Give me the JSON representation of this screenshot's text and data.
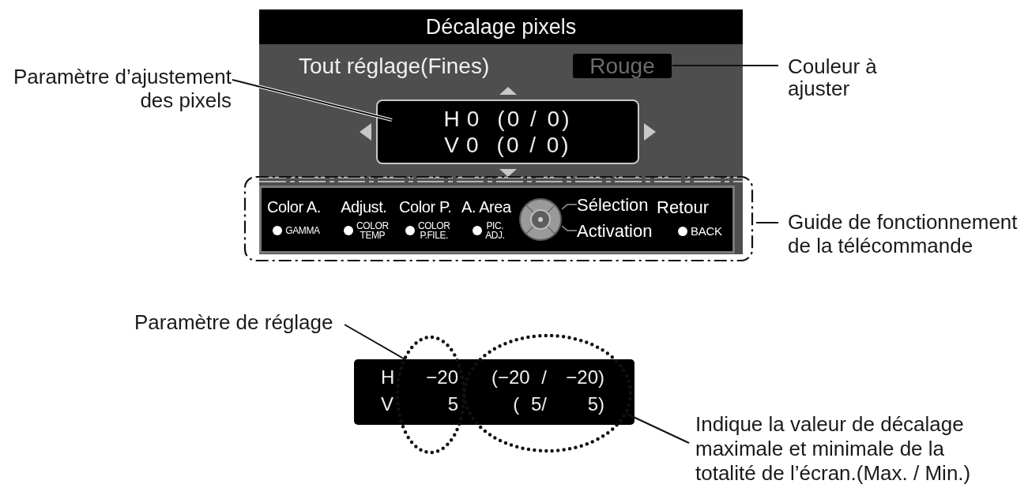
{
  "screen": {
    "title": "Décalage pixels",
    "mode": "Tout réglage(Fines)",
    "color_channel": "Rouge",
    "readout": [
      {
        "axis": "H",
        "value": "0",
        "range": "(0 / 0)"
      },
      {
        "axis": "V",
        "value": "0",
        "range": "(0 / 0)"
      }
    ],
    "guide": {
      "keys": [
        {
          "label": "Color A.",
          "button": "GAMMA"
        },
        {
          "label": "Adjust.",
          "button": "COLOR\nTEMP"
        },
        {
          "label": "Color P.",
          "button": "COLOR\nP.FILE."
        },
        {
          "label": "A. Area",
          "button": "PIC.\nADJ."
        }
      ],
      "joystick": {
        "select": "Sélection",
        "enter": "Activation"
      },
      "back": {
        "label": "Retour",
        "button": "BACK"
      }
    }
  },
  "callouts": {
    "pixel_parameter": "Paramètre d’ajustement\ndes pixels",
    "color_to_adjust": "Couleur à\najuster",
    "remote_guide": "Guide de fonctionnement\nde la télécommande",
    "setting_parameter": "Paramètre de réglage",
    "range_note": "Indique la valeur de décalage\nmaximale et minimale de la\ntotalité de l’écran.(Max. / Min.)"
  },
  "example": {
    "rows": [
      {
        "axis": "H",
        "value": "−20",
        "range_max": "(−20 /",
        "range_min": "−20)"
      },
      {
        "axis": "V",
        "value": "5",
        "range_max": "( 5/",
        "range_min": "5)"
      }
    ]
  }
}
